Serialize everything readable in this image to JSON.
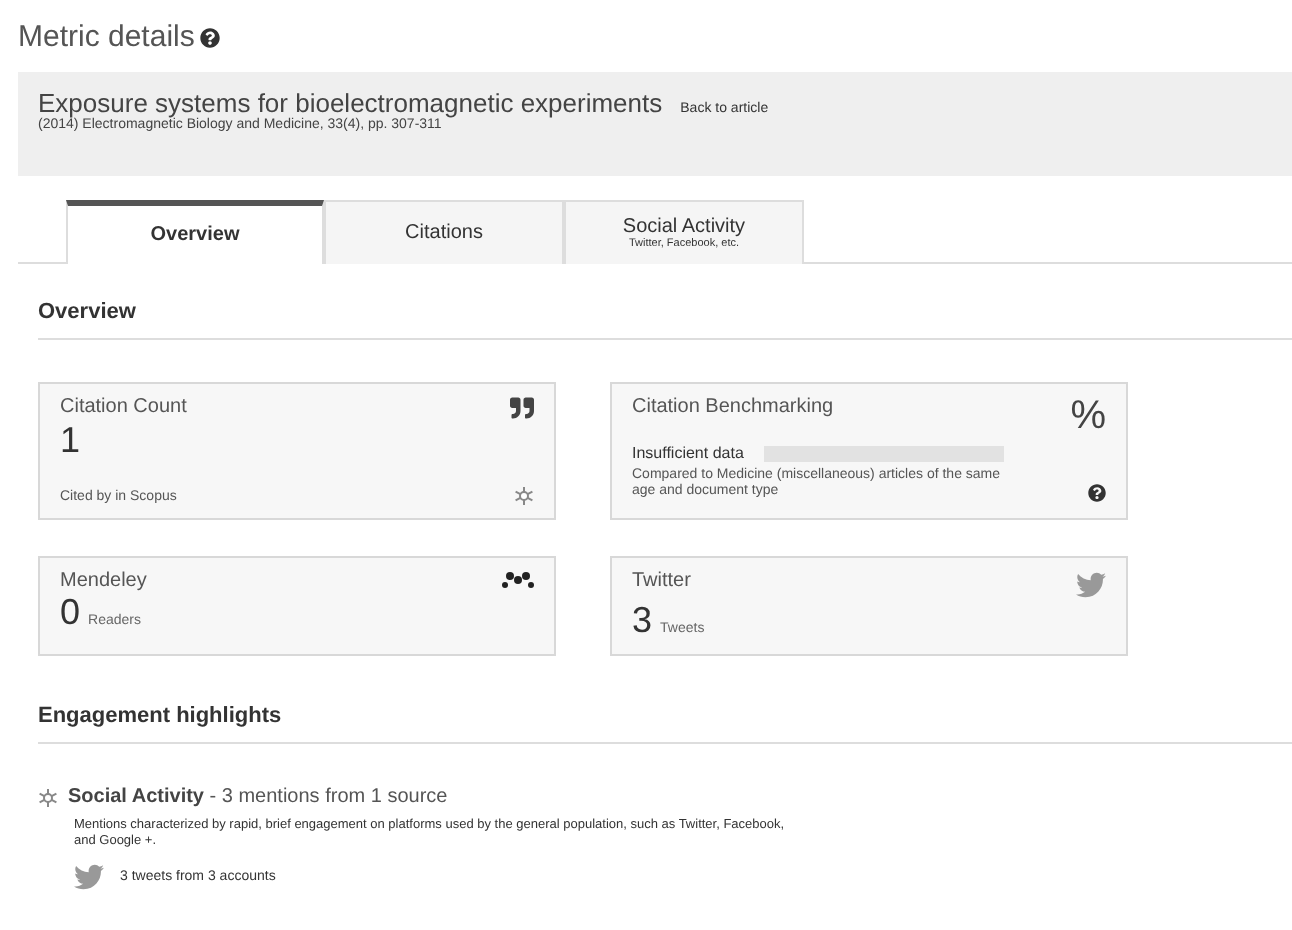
{
  "page_title": "Metric details",
  "article": {
    "title": "Exposure systems for bioelectromagnetic experiments",
    "back_link": "Back to article",
    "citation": "(2014) Electromagnetic Biology and Medicine, 33(4), pp. 307-311"
  },
  "tabs": [
    {
      "label": "Overview",
      "selected": true
    },
    {
      "label": "Citations",
      "selected": false
    },
    {
      "label": "Social Activity",
      "sublabel": "Twitter, Facebook, etc.",
      "selected": false
    }
  ],
  "overview": {
    "heading": "Overview",
    "cards": [
      {
        "kind": "metric",
        "title": "Citation Count",
        "value": "1",
        "footnote": "Cited by in Scopus"
      },
      {
        "kind": "benchmark",
        "symbol": "%",
        "title": "Citation Benchmarking",
        "status": "Insufficient data",
        "note": "Compared to Medicine (miscellaneous) articles of the same age and document type"
      },
      {
        "kind": "metric",
        "title": "Mendeley",
        "value": "0",
        "unit": "Readers"
      },
      {
        "kind": "metric",
        "title": "Twitter",
        "value": "3",
        "unit": "Tweets"
      }
    ]
  },
  "engagement": {
    "heading": "Engagement highlights",
    "items": [
      {
        "title": "**Social Activity** - 3 mentions from 1 source",
        "description": "Mentions characterized by rapid, brief engagement on platforms used by the general population, such as Twitter, Facebook, and Google +.",
        "details": [
          {
            "text": "3 tweets from 3 accounts"
          }
        ]
      }
    ]
  }
}
